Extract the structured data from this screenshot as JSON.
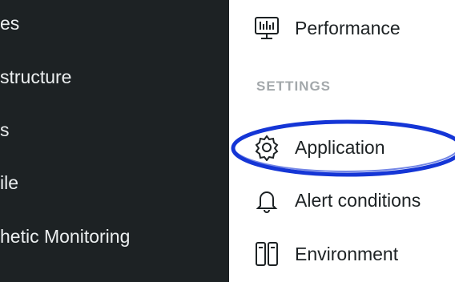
{
  "left_nav": {
    "items": [
      {
        "label": "es"
      },
      {
        "label": "structure"
      },
      {
        "label": "s"
      },
      {
        "label": "ile"
      },
      {
        "label": "hetic Monitoring"
      }
    ]
  },
  "right_nav": {
    "performance": {
      "label": "Performance",
      "icon": "performance-monitor-icon"
    },
    "settings_heading": "SETTINGS",
    "application": {
      "label": "Application",
      "icon": "gear-icon"
    },
    "alert_conditions": {
      "label": "Alert conditions",
      "icon": "bell-icon"
    },
    "environment": {
      "label": "Environment",
      "icon": "environment-icon"
    }
  },
  "colors": {
    "left_bg": "#1d2224",
    "annotation": "#1536d6"
  }
}
